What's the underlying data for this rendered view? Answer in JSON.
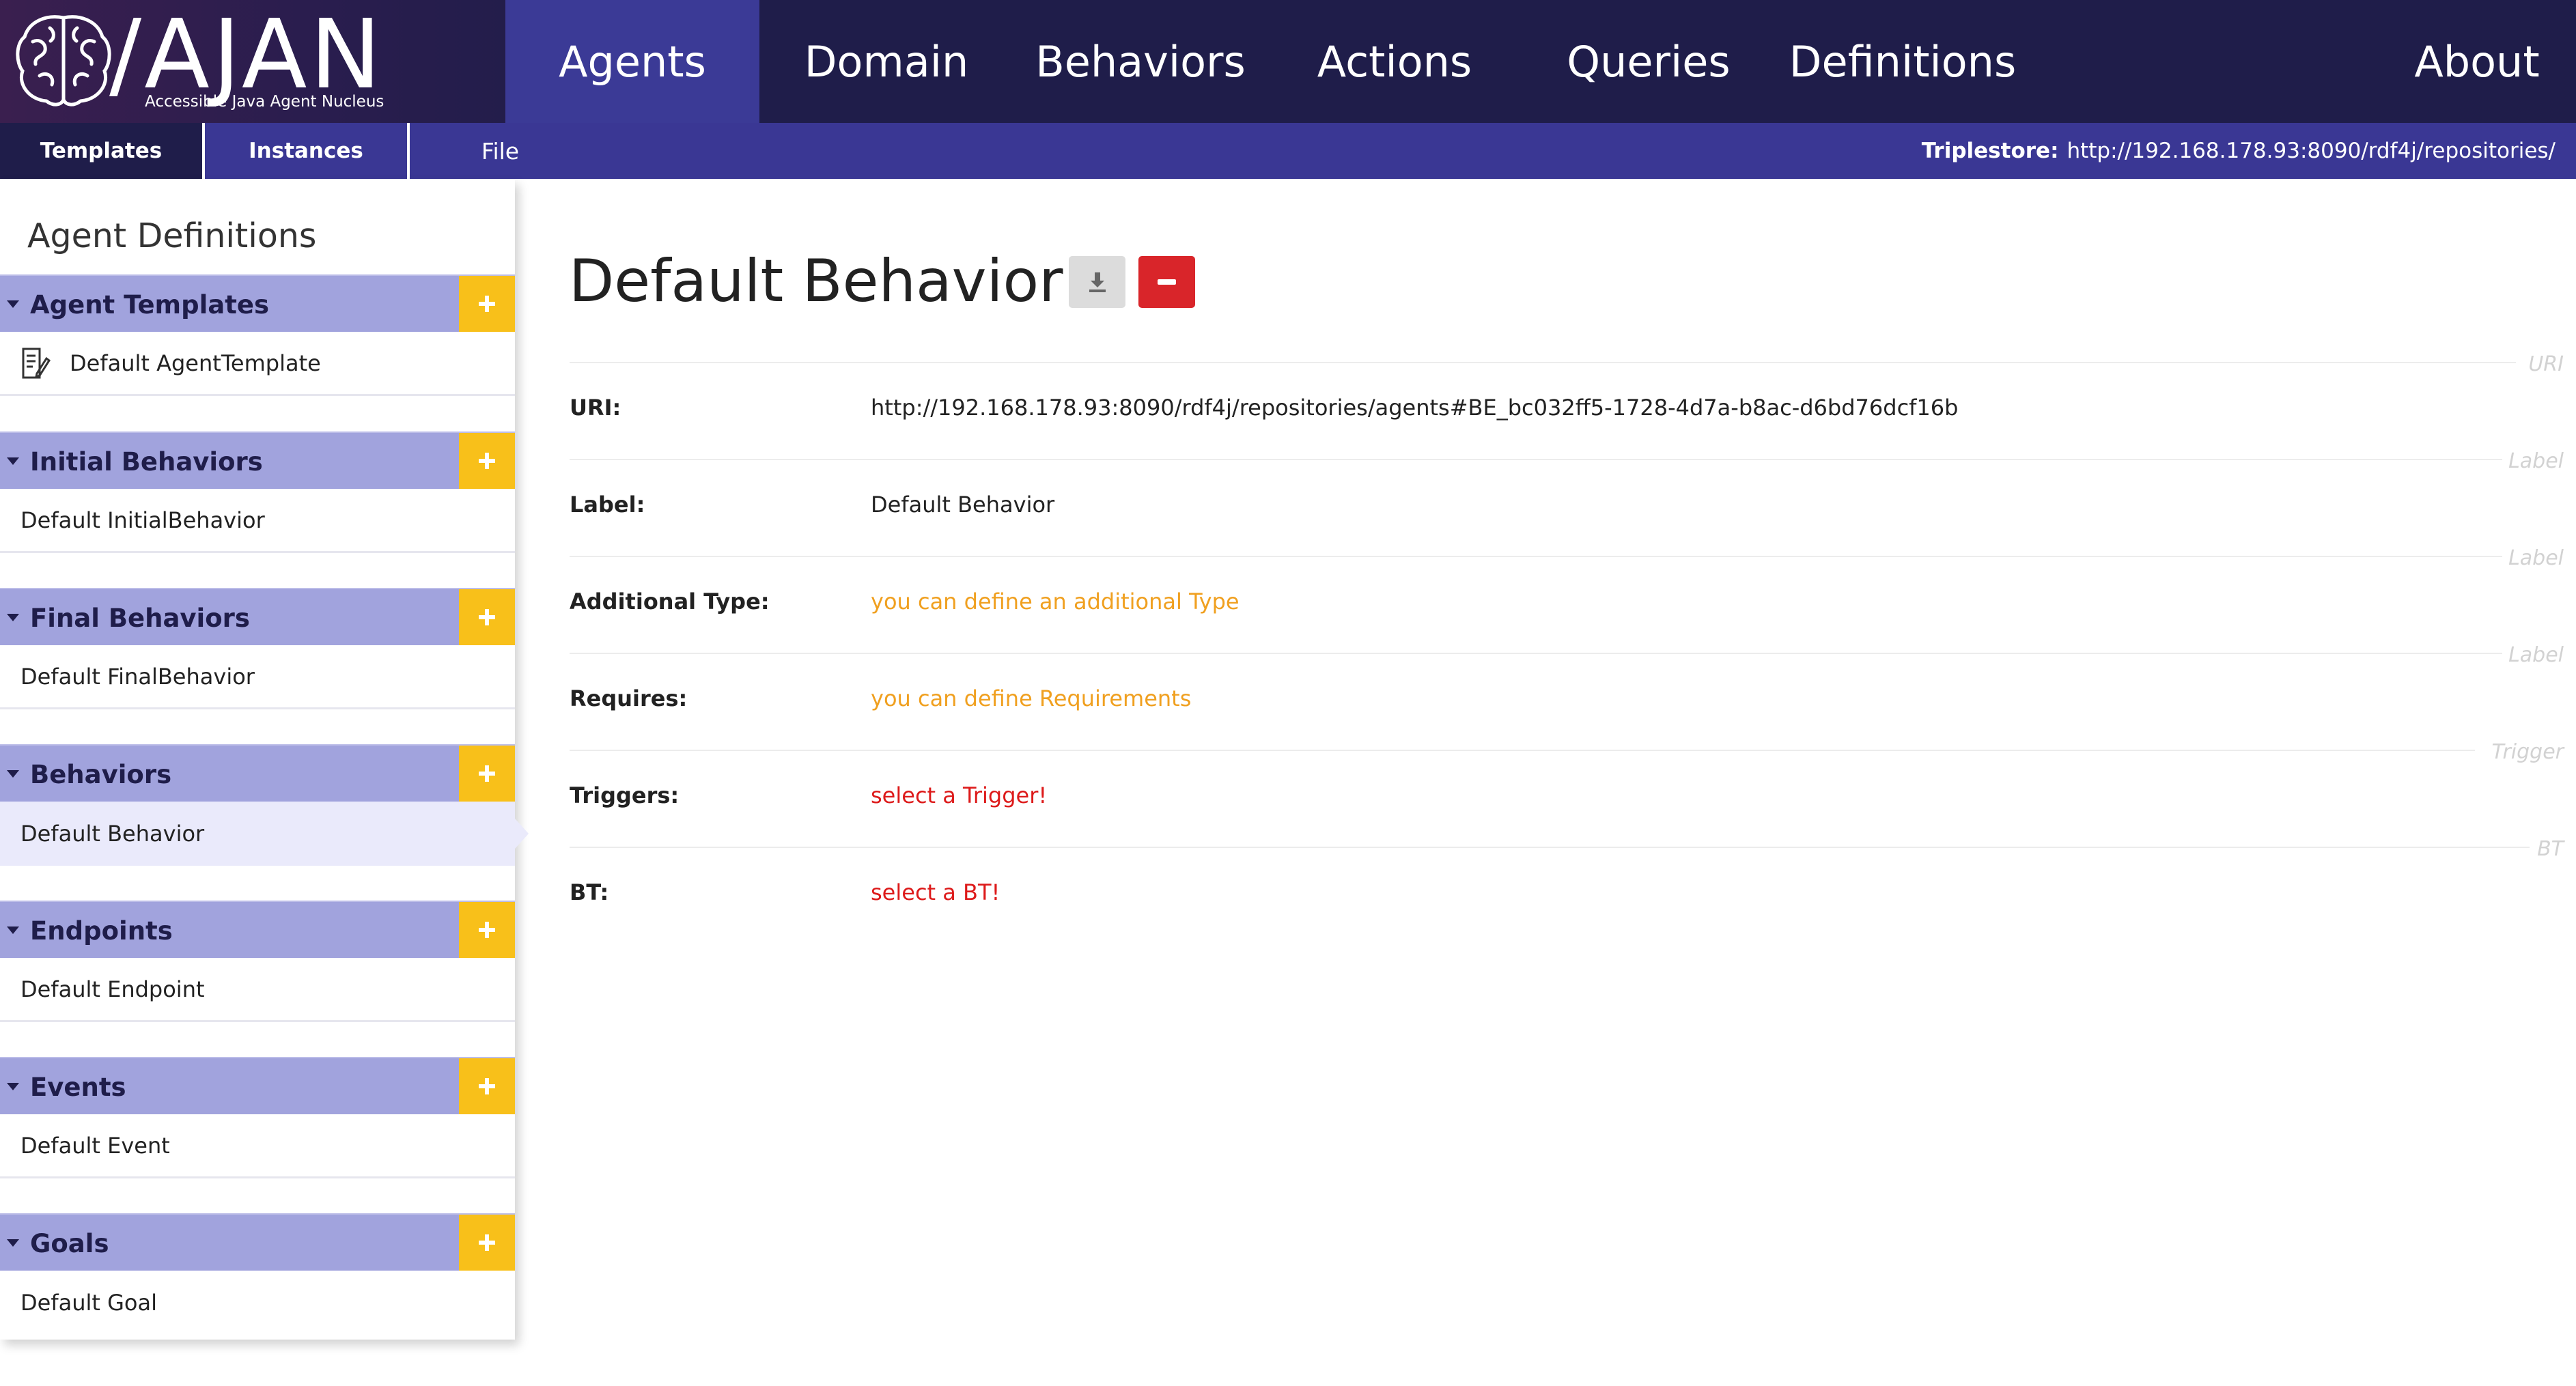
{
  "logo": {
    "title": "/AJAN",
    "subtitle": "Accessible Java Agent Nucleus"
  },
  "nav": {
    "items": [
      {
        "label": "Agents",
        "active": true
      },
      {
        "label": "Domain",
        "active": false
      },
      {
        "label": "Behaviors",
        "active": false
      },
      {
        "label": "Actions",
        "active": false
      },
      {
        "label": "Queries",
        "active": false
      },
      {
        "label": "Definitions",
        "active": false
      }
    ],
    "about": "About"
  },
  "subnav": {
    "templates": "Templates",
    "instances": "Instances",
    "file": "File",
    "triplestore_label": "Triplestore:",
    "triplestore_url": "http://192.168.178.93:8090/rdf4j/repositories/"
  },
  "sidebar": {
    "title": "Agent Definitions",
    "sections": [
      {
        "label": "Agent Templates",
        "items": [
          "Default AgentTemplate"
        ]
      },
      {
        "label": "Initial Behaviors",
        "items": [
          "Default InitialBehavior"
        ]
      },
      {
        "label": "Final Behaviors",
        "items": [
          "Default FinalBehavior"
        ]
      },
      {
        "label": "Behaviors",
        "items": [
          "Default Behavior"
        ]
      },
      {
        "label": "Endpoints",
        "items": [
          "Default Endpoint"
        ]
      },
      {
        "label": "Events",
        "items": [
          "Default Event"
        ]
      },
      {
        "label": "Goals",
        "items": [
          "Default Goal"
        ]
      }
    ],
    "selected": "Default Behavior"
  },
  "main": {
    "title": "Default Behavior",
    "properties": [
      {
        "tag": "URI",
        "label": "URI:",
        "value": "http://192.168.178.93:8090/rdf4j/repositories/agents#BE_bc032ff5-1728-4d7a-b8ac-d6bd76dcf16b",
        "style": "normal"
      },
      {
        "tag": "Label",
        "label": "Label:",
        "value": "Default Behavior",
        "style": "normal"
      },
      {
        "tag": "Label",
        "label": "Additional Type:",
        "value": "you can define an additional Type",
        "style": "orange"
      },
      {
        "tag": "Label",
        "label": "Requires:",
        "value": "you can define Requirements",
        "style": "orange"
      },
      {
        "tag": "Trigger",
        "label": "Triggers:",
        "value": "select a Trigger!",
        "style": "red"
      },
      {
        "tag": "BT",
        "label": "BT:",
        "value": "select a BT!",
        "style": "red"
      }
    ]
  },
  "colors": {
    "header_bg": "#1f1d4a",
    "nav_active": "#3b3a96",
    "subbar": "#3a3794",
    "section_header": "#a1a3dd",
    "add_button": "#f8c01a",
    "delete_button": "#d9252a",
    "hint_orange": "#f0a020",
    "hint_red": "#dd1a1a"
  }
}
